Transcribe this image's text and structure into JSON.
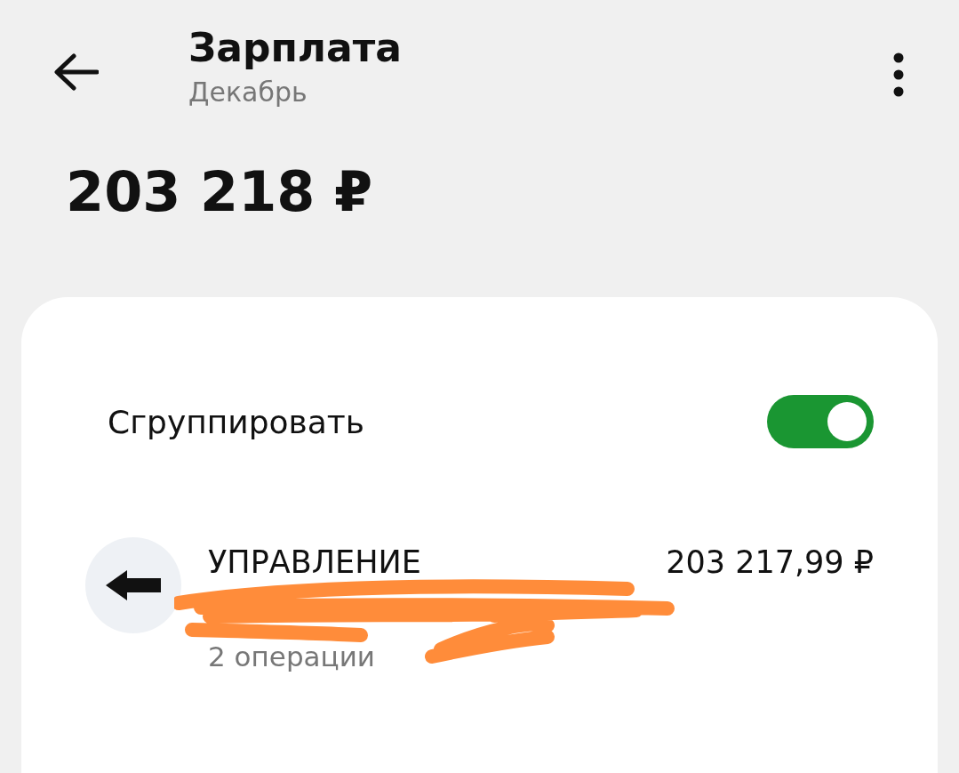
{
  "header": {
    "title": "Зарплата",
    "subtitle": "Декабрь"
  },
  "balance": "203 218 ₽",
  "group_toggle": {
    "label": "Сгруппировать",
    "on": true
  },
  "operations": [
    {
      "title": "УПРАВЛЕНИЕ",
      "amount": "203 217,99 ₽",
      "count": "2 операции",
      "redacted": true
    }
  ]
}
